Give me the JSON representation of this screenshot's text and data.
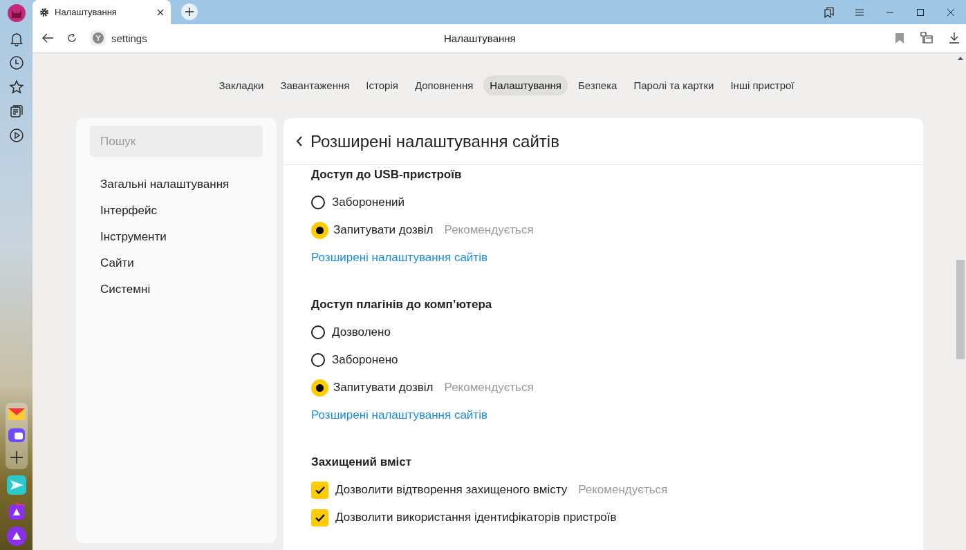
{
  "browser_tab": {
    "title": "Налаштування"
  },
  "address_bar": {
    "text": "settings"
  },
  "page_title": "Налаштування",
  "nav_tabs": [
    {
      "label": "Закладки",
      "selected": false
    },
    {
      "label": "Завантаження",
      "selected": false
    },
    {
      "label": "Історія",
      "selected": false
    },
    {
      "label": "Доповнення",
      "selected": false
    },
    {
      "label": "Налаштування",
      "selected": true
    },
    {
      "label": "Безпека",
      "selected": false
    },
    {
      "label": "Паролі та картки",
      "selected": false
    },
    {
      "label": "Інші пристрої",
      "selected": false
    }
  ],
  "search": {
    "placeholder": "Пошук"
  },
  "sidebar": {
    "items": [
      "Загальні налаштування",
      "Інтерфейс",
      "Інструменти",
      "Сайти",
      "Системні"
    ]
  },
  "panel": {
    "title": "Розширені налаштування сайтів",
    "sections": [
      {
        "title": "Доступ до USB-пристроїв",
        "options": [
          {
            "kind": "radio",
            "label": "Заборонений",
            "selected": false
          },
          {
            "kind": "radio",
            "label": "Запитувати дозвіл",
            "selected": true,
            "note": "Рекомендується"
          }
        ],
        "link": "Розширені налаштування сайтів"
      },
      {
        "title": "Доступ плагінів до комп’ютера",
        "options": [
          {
            "kind": "radio",
            "label": "Дозволено",
            "selected": false
          },
          {
            "kind": "radio",
            "label": "Заборонено",
            "selected": false
          },
          {
            "kind": "radio",
            "label": "Запитувати дозвіл",
            "selected": true,
            "note": "Рекомендується"
          }
        ],
        "link": "Розширені налаштування сайтів"
      },
      {
        "title": "Захищений вміст",
        "options": [
          {
            "kind": "checkbox",
            "label": "Дозволити відтворення захищеного вмісту",
            "checked": true,
            "note": "Рекомендується"
          },
          {
            "kind": "checkbox",
            "label": "Дозволити використання ідентифікаторів пристроїв",
            "checked": true
          }
        ]
      }
    ]
  }
}
